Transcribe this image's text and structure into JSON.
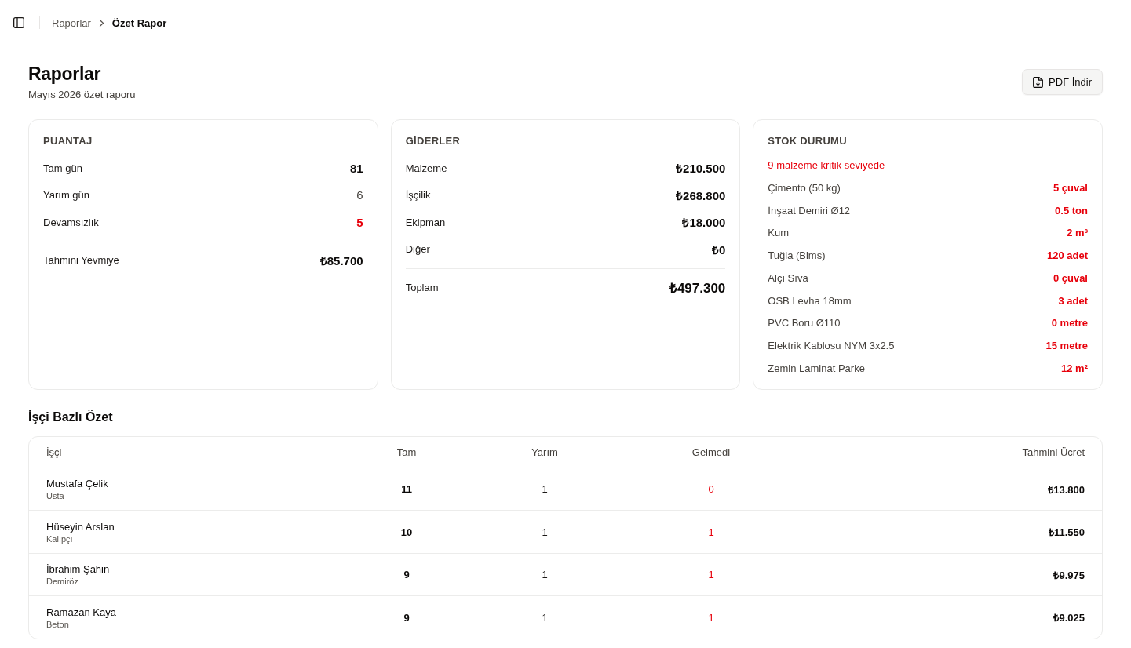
{
  "breadcrumb": [
    {
      "label": "Raporlar",
      "current": false
    },
    {
      "label": "Özet Rapor",
      "current": true
    }
  ],
  "header": {
    "title": "Raporlar",
    "subtitle": "Mayıs 2026 özet raporu",
    "button": "PDF İndir"
  },
  "cards": [
    {
      "kind": "summary",
      "title": "PUANTAJ",
      "rows": [
        {
          "label": "Tam gün",
          "value": "81",
          "muted": false,
          "critical": false
        },
        {
          "label": "Yarım gün",
          "value": "6",
          "muted": true,
          "critical": false
        },
        {
          "label": "Devamsızlık",
          "value": "5",
          "muted": false,
          "critical": true
        }
      ],
      "total": {
        "label": "Tahmini Yevmiye",
        "value": "₺85.700",
        "kind": "subtotal"
      }
    },
    {
      "kind": "summary",
      "title": "GİDERLER",
      "rows": [
        {
          "label": "Malzeme",
          "value": "₺210.500",
          "muted": false,
          "critical": false
        },
        {
          "label": "İşçilik",
          "value": "₺268.800",
          "muted": false,
          "critical": false
        },
        {
          "label": "Ekipman",
          "value": "₺18.000",
          "muted": false,
          "critical": false
        },
        {
          "label": "Diğer",
          "value": "₺0",
          "muted": false,
          "critical": false
        }
      ],
      "total": {
        "label": "Toplam",
        "value": "₺497.300",
        "kind": "grand"
      }
    },
    {
      "kind": "stock",
      "title": "STOK DURUMU",
      "alert": "9 malzeme kritik seviyede",
      "items": [
        {
          "name": "Çimento (50 kg)",
          "quantity": "5 çuval",
          "critical": true
        },
        {
          "name": "İnşaat Demiri Ø12",
          "quantity": "0.5 ton",
          "critical": true
        },
        {
          "name": "Kum",
          "quantity": "2 m³",
          "critical": true
        },
        {
          "name": "Tuğla (Bims)",
          "quantity": "120 adet",
          "critical": true
        },
        {
          "name": "Alçı Sıva",
          "quantity": "0 çuval",
          "critical": true
        },
        {
          "name": "OSB Levha 18mm",
          "quantity": "3 adet",
          "critical": true
        },
        {
          "name": "PVC Boru Ø110",
          "quantity": "0 metre",
          "critical": true
        },
        {
          "name": "Elektrik Kablosu NYM 3x2.5",
          "quantity": "15 metre",
          "critical": true
        },
        {
          "name": "Zemin Laminat Parke",
          "quantity": "12 m²",
          "critical": true
        }
      ]
    }
  ],
  "workers": {
    "title": "İşçi Bazlı Özet",
    "columns": [
      "İşçi",
      "Tam",
      "Yarım",
      "Gelmedi",
      "Tahmini Ücret"
    ],
    "rows": [
      {
        "name": "Mustafa Çelik",
        "role": "Usta",
        "full": "11",
        "half": "1",
        "absent": "0",
        "wage": "₺13.800"
      },
      {
        "name": "Hüseyin Arslan",
        "role": "Kalıpçı",
        "full": "10",
        "half": "1",
        "absent": "1",
        "wage": "₺11.550"
      },
      {
        "name": "İbrahim Şahin",
        "role": "Demiröz",
        "full": "9",
        "half": "1",
        "absent": "1",
        "wage": "₺9.975"
      },
      {
        "name": "Ramazan Kaya",
        "role": "Beton",
        "full": "9",
        "half": "1",
        "absent": "1",
        "wage": "₺9.025"
      }
    ]
  }
}
